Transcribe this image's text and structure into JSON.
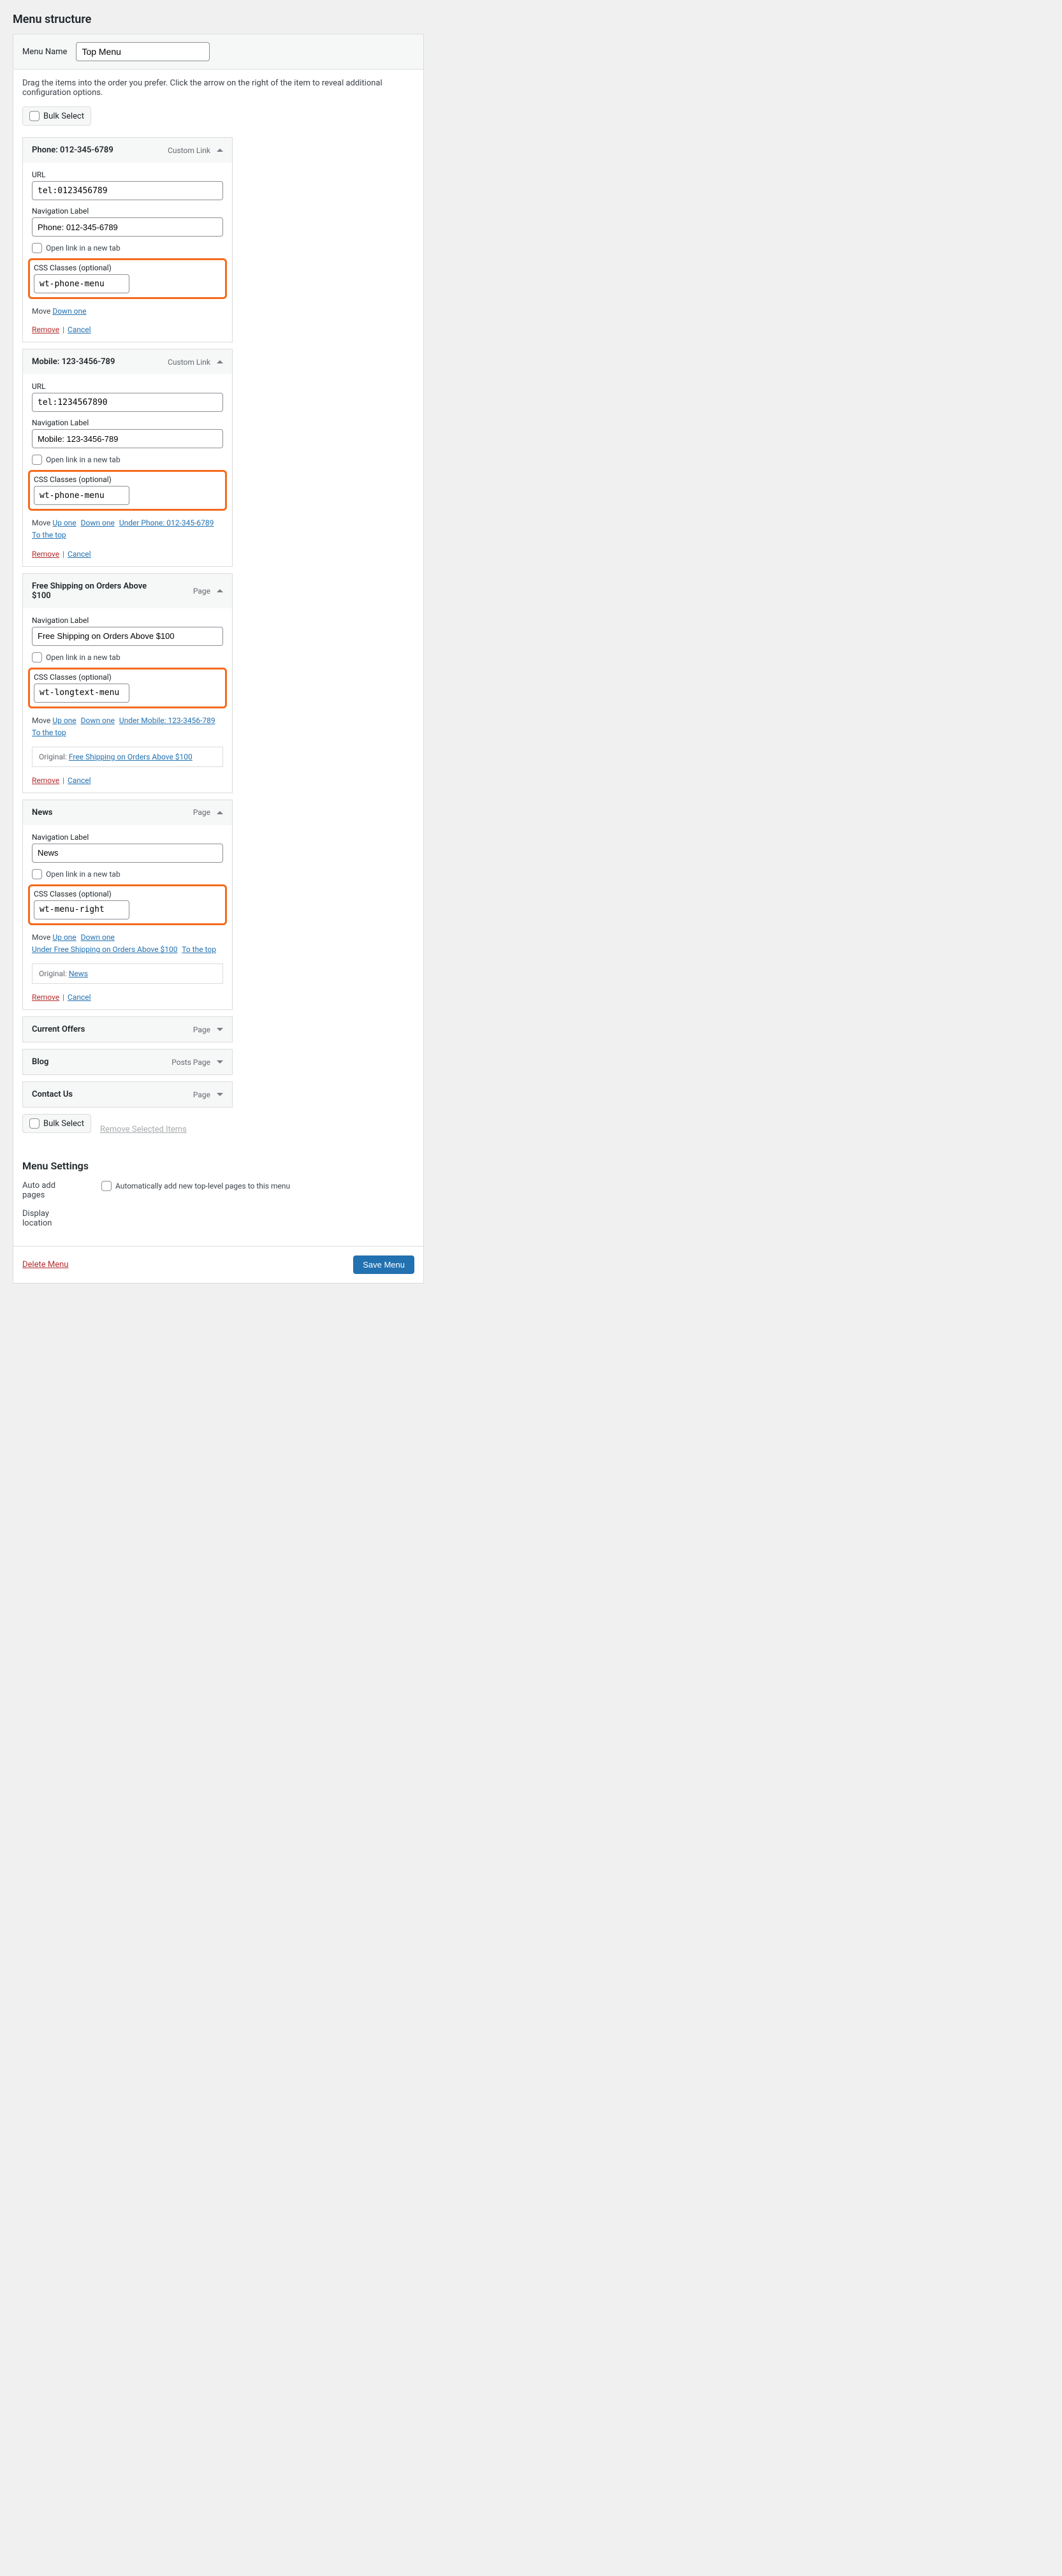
{
  "heading": "Menu structure",
  "menu_name_label": "Menu Name",
  "menu_name_value": "Top Menu",
  "instructions": "Drag the items into the order you prefer. Click the arrow on the right of the item to reveal additional configuration options.",
  "bulk_select": "Bulk Select",
  "remove_selected": "Remove Selected Items",
  "common": {
    "url": "URL",
    "nav_label": "Navigation Label",
    "open_new_tab": "Open link in a new tab",
    "css_classes": "CSS Classes (optional)",
    "move": "Move",
    "up_one": "Up one",
    "down_one": "Down one",
    "to_the_top": "To the top",
    "remove": "Remove",
    "cancel": "Cancel",
    "original": "Original:"
  },
  "items": [
    {
      "title": "Phone: 012-345-6789",
      "type": "Custom Link",
      "expanded": true,
      "url": "tel:0123456789",
      "nav_label": "Phone: 012-345-6789",
      "css": "wt-phone-menu",
      "move_links": [
        "down_one"
      ],
      "under": null,
      "original": null
    },
    {
      "title": "Mobile: 123-3456-789",
      "type": "Custom Link",
      "expanded": true,
      "url": "tel:1234567890",
      "nav_label": "Mobile: 123-3456-789",
      "css": "wt-phone-menu",
      "move_links": [
        "up_one",
        "down_one"
      ],
      "under": "Under Phone: 012-345-6789",
      "to_top": true,
      "original": null
    },
    {
      "title": "Free Shipping on Orders Above $100",
      "type": "Page",
      "expanded": true,
      "url": null,
      "nav_label": "Free Shipping on Orders Above $100",
      "css": "wt-longtext-menu",
      "move_links": [
        "up_one",
        "down_one"
      ],
      "under": "Under Mobile: 123-3456-789",
      "to_top": true,
      "original": "Free Shipping on Orders Above $100"
    },
    {
      "title": "News",
      "type": "Page",
      "expanded": true,
      "url": null,
      "nav_label": "News",
      "css": "wt-menu-right",
      "move_links": [
        "up_one",
        "down_one"
      ],
      "under": "Under Free Shipping on Orders Above $100",
      "to_top": true,
      "to_top_inline": true,
      "original": "News"
    },
    {
      "title": "Current Offers",
      "type": "Page",
      "expanded": false
    },
    {
      "title": "Blog",
      "type": "Posts Page",
      "expanded": false
    },
    {
      "title": "Contact Us",
      "type": "Page",
      "expanded": false
    }
  ],
  "settings": {
    "heading": "Menu Settings",
    "auto_add_label": "Auto add pages",
    "auto_add_check": "Automatically add new top-level pages to this menu",
    "display_location": "Display location"
  },
  "footer": {
    "delete": "Delete Menu",
    "save": "Save Menu"
  }
}
